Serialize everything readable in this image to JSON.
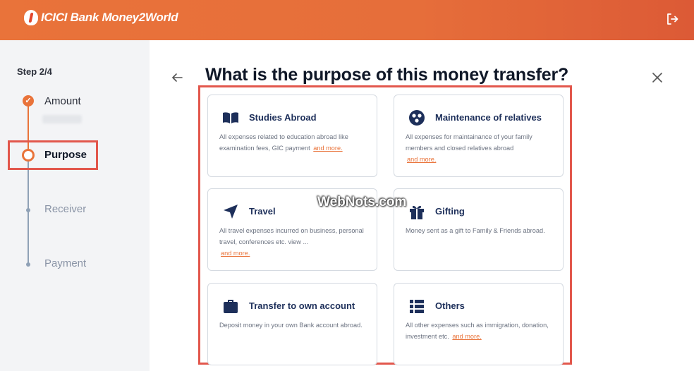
{
  "header": {
    "brand": "ICICI Bank Money2World",
    "logout_icon": "logout-icon",
    "brand_color": "#e9733a"
  },
  "sidebar": {
    "step": "Step 2/4",
    "steps": [
      {
        "label": "Amount",
        "state": "done"
      },
      {
        "label": "Purpose",
        "state": "current"
      },
      {
        "label": "Receiver",
        "state": "pending"
      },
      {
        "label": "Payment",
        "state": "pending"
      }
    ]
  },
  "main": {
    "title": "What is the purpose of this money transfer?",
    "back_icon": "back-arrow-icon",
    "close_icon": "close-icon",
    "cards": [
      {
        "icon": "book-icon",
        "title": "Studies Abroad",
        "desc": "All expenses related to education abroad like examination fees, GIC payment",
        "more": "and more."
      },
      {
        "icon": "people-icon",
        "title": "Maintenance of relatives",
        "desc": "All expenses for maintainance of your family members and closed relatives abroad",
        "more": "and more."
      },
      {
        "icon": "navigation-icon",
        "title": "Travel",
        "desc": "All travel expenses incurred on business, personal travel, conferences etc. view ...",
        "more": "and more."
      },
      {
        "icon": "gift-icon",
        "title": "Gifting",
        "desc": "Money sent as a gift to Family & Friends abroad.",
        "more": ""
      },
      {
        "icon": "briefcase-icon",
        "title": "Transfer to own account",
        "desc": "Deposit money in your own Bank account abroad.",
        "more": ""
      },
      {
        "icon": "list-icon",
        "title": "Others",
        "desc": "All other expenses such as immigration, donation, investment etc.",
        "more": "and more."
      }
    ]
  },
  "watermark": "WebNots.com"
}
